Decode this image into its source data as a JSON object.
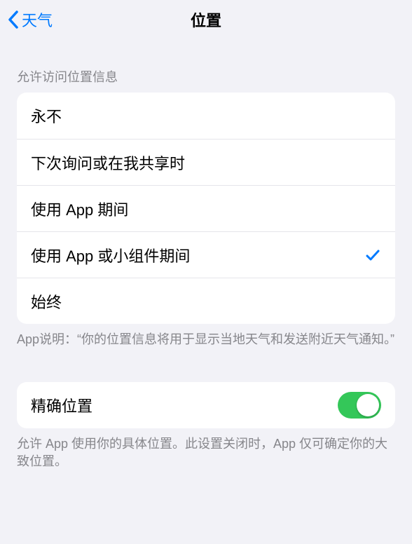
{
  "nav": {
    "back_label": "天气",
    "title": "位置"
  },
  "section1": {
    "header": "允许访问位置信息",
    "options": [
      {
        "label": "永不",
        "selected": false
      },
      {
        "label": "下次询问或在我共享时",
        "selected": false
      },
      {
        "label": "使用 App 期间",
        "selected": false
      },
      {
        "label": "使用 App 或小组件期间",
        "selected": true
      },
      {
        "label": "始终",
        "selected": false
      }
    ],
    "footer": "App说明：“你的位置信息将用于显示当地天气和发送附近天气通知。”"
  },
  "section2": {
    "precise_location_label": "精确位置",
    "precise_location_on": true,
    "footer": "允许 App 使用你的具体位置。此设置关闭时，App 仅可确定你的大致位置。"
  }
}
